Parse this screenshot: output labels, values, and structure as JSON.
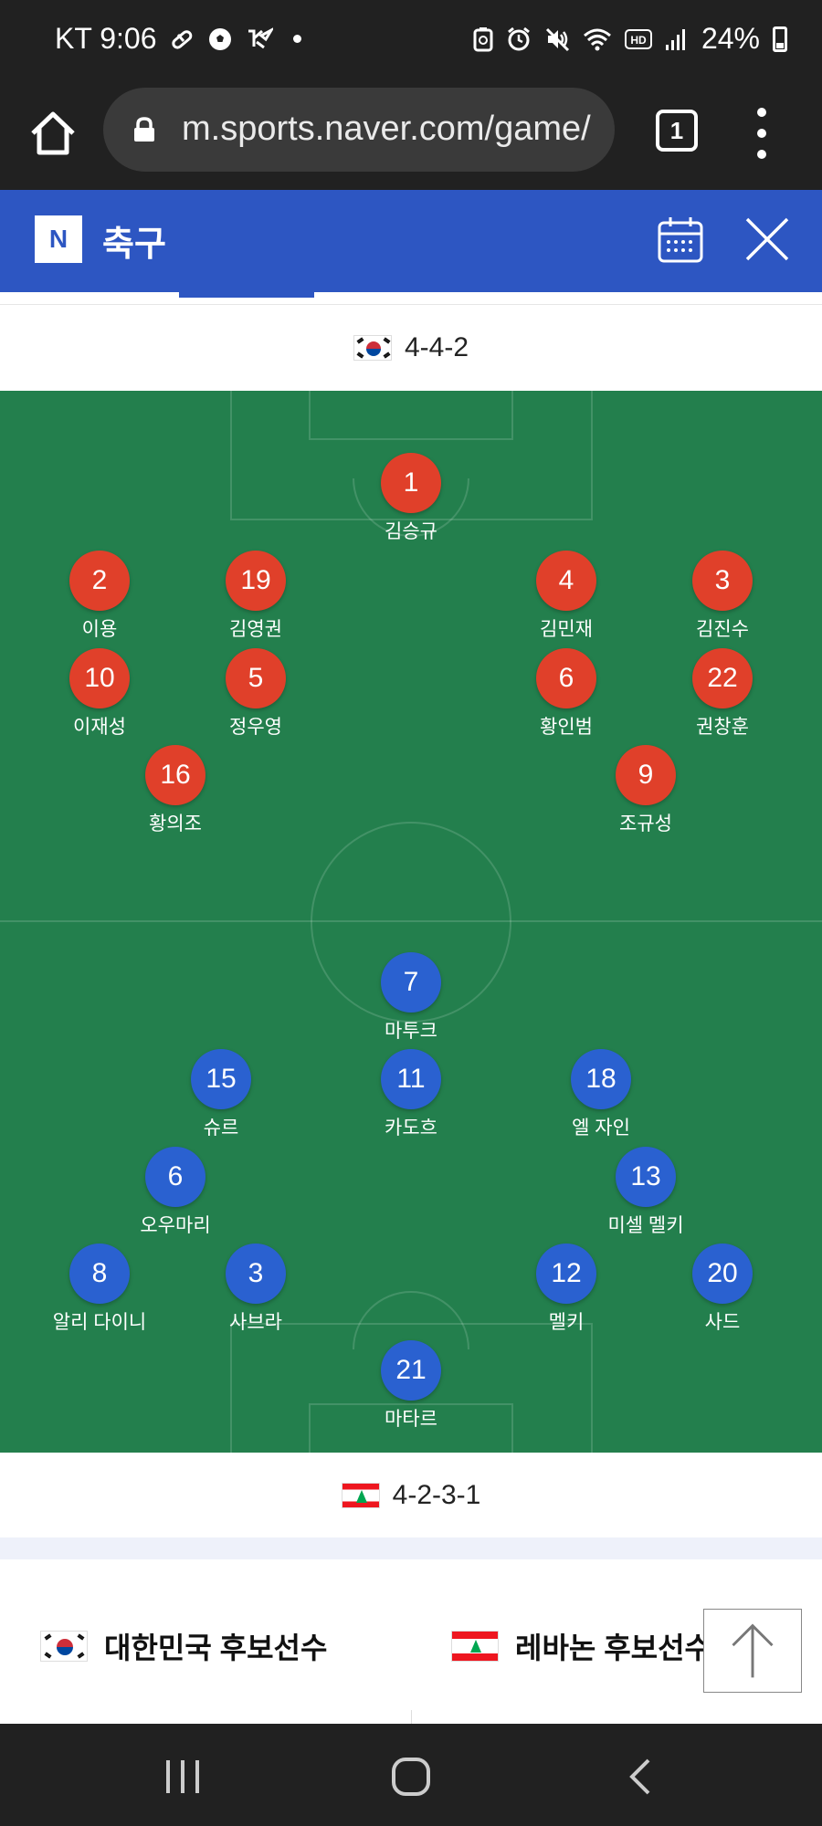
{
  "status_bar": {
    "carrier_time": "KT 9:06",
    "battery_percent": "24%",
    "left_icons": [
      "pill-icon",
      "soccer-ball-icon",
      "sports-app-icon",
      "notification-dot-icon"
    ],
    "right_icons": [
      "battery-saver-icon",
      "alarm-icon",
      "mute-icon",
      "wifi-icon",
      "hd-voice-icon",
      "signal-icon",
      "battery-icon"
    ]
  },
  "browser": {
    "url": "m.sports.naver.com/game/",
    "tab_count": "1"
  },
  "header": {
    "logo": "N",
    "title": "축구"
  },
  "home_team": {
    "formation": "4-4-2",
    "flag": "korea",
    "players": [
      {
        "number": "1",
        "name": "김승규"
      },
      {
        "number": "2",
        "name": "이용"
      },
      {
        "number": "19",
        "name": "김영권"
      },
      {
        "number": "4",
        "name": "김민재"
      },
      {
        "number": "3",
        "name": "김진수"
      },
      {
        "number": "10",
        "name": "이재성"
      },
      {
        "number": "5",
        "name": "정우영"
      },
      {
        "number": "6",
        "name": "황인범"
      },
      {
        "number": "22",
        "name": "권창훈"
      },
      {
        "number": "16",
        "name": "황의조"
      },
      {
        "number": "9",
        "name": "조규성"
      }
    ]
  },
  "away_team": {
    "formation": "4-2-3-1",
    "flag": "lebanon",
    "players": [
      {
        "number": "7",
        "name": "마투크"
      },
      {
        "number": "15",
        "name": "슈르"
      },
      {
        "number": "11",
        "name": "카도흐"
      },
      {
        "number": "18",
        "name": "엘 자인"
      },
      {
        "number": "6",
        "name": "오우마리"
      },
      {
        "number": "13",
        "name": "미셀 멜키"
      },
      {
        "number": "8",
        "name": "알리 다이니"
      },
      {
        "number": "3",
        "name": "사브라"
      },
      {
        "number": "12",
        "name": "멜키"
      },
      {
        "number": "20",
        "name": "사드"
      },
      {
        "number": "21",
        "name": "마타르"
      }
    ]
  },
  "substitutes": {
    "home_label": "대한민국 후보선수",
    "away_label": "레바논 후보선수"
  },
  "colors": {
    "naver_blue": "#2d56c2",
    "home_marker": "#e0402a",
    "away_marker": "#2a61d0",
    "pitch": "#237f4d"
  }
}
